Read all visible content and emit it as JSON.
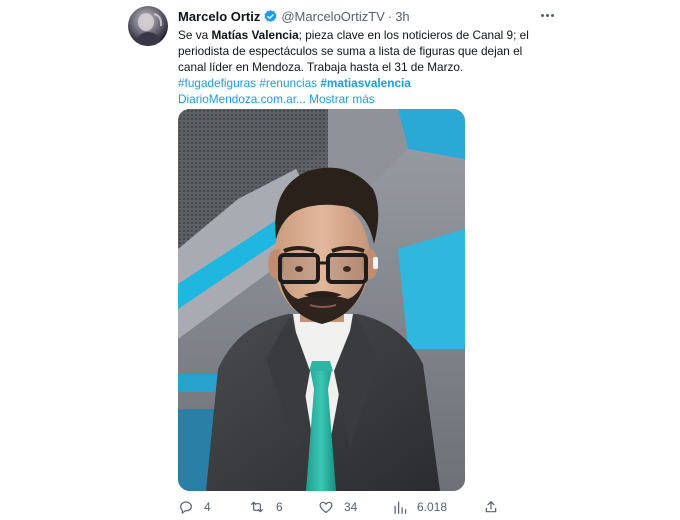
{
  "author": {
    "name": "Marcelo Ortiz",
    "handle": "@MarceloOrtizTV",
    "separator": "·",
    "time": "3h"
  },
  "tweet": {
    "line1_pre": "Se va ",
    "line1_bold": "Matías Valencia",
    "line1_post": "; pieza clave en los noticieros de Canal 9;  el periodista de espectáculos se suma a lista de figuras que dejan el canal líder en Mendoza. Trabaja hasta el 31 de Marzo.",
    "hashtags": [
      "#fugadefiguras",
      "#renuncias",
      "#matiasvalencia"
    ],
    "link": "DiarioMendoza.com.ar...",
    "show_more": "Mostrar más"
  },
  "actions": {
    "replies": "4",
    "retweets": "6",
    "likes": "34",
    "views": "6.018"
  },
  "icons": [
    "verified-badge-icon",
    "more-icon",
    "reply-icon",
    "retweet-icon",
    "like-icon",
    "views-icon",
    "share-icon"
  ],
  "colors": {
    "accent": "#1d9bf0",
    "muted": "#536471",
    "text": "#0f1419"
  }
}
